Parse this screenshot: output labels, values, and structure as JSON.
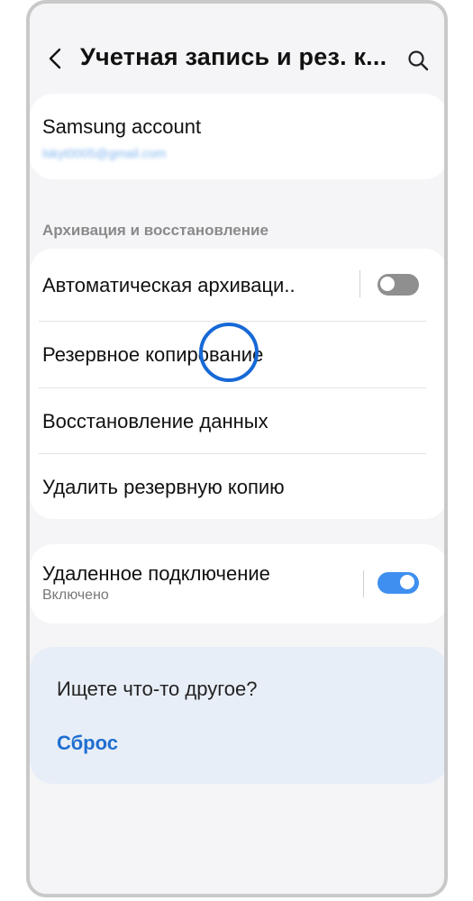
{
  "header": {
    "title": "Учетная запись и рез. к...",
    "back_icon": "chevron-left-icon",
    "search_icon": "search-icon"
  },
  "account": {
    "title": "Samsung account",
    "email": "lskyt0005@gmail.com"
  },
  "backup_section": {
    "heading": "Архивация и восстановление",
    "items": [
      {
        "label": "Автоматическая архиваци..",
        "toggle": false
      },
      {
        "label": "Резервное копирование"
      },
      {
        "label": "Восстановление данных"
      },
      {
        "label": "Удалить резервную копию"
      }
    ]
  },
  "remote": {
    "title": "Удаленное подключение",
    "status": "Включено",
    "toggle": true
  },
  "other": {
    "question": "Ищете что-то другое?",
    "link": "Сброс"
  },
  "colors": {
    "accent": "#3e8ff0",
    "link": "#1f6fd0",
    "touch_indicator": "#1769d6"
  }
}
